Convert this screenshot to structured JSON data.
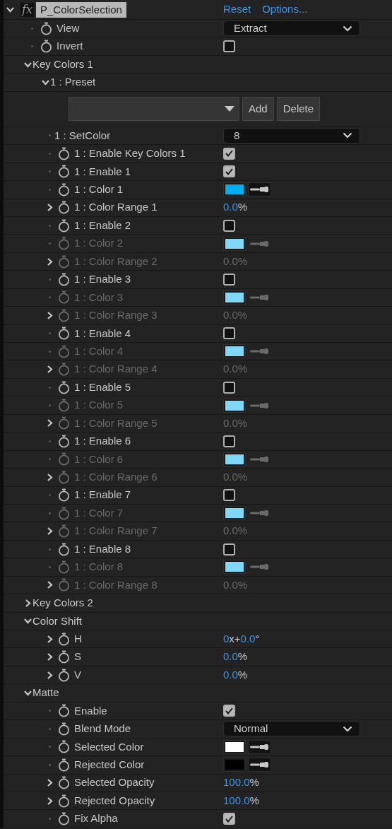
{
  "effect": {
    "badge": "fx",
    "name": "P_ColorSelection",
    "expanded": true,
    "links": [
      "Reset",
      "Options..."
    ],
    "params": [
      {
        "kind": "dropdown",
        "label": "View",
        "stopwatch": true,
        "disabled": false,
        "value": "Extract"
      },
      {
        "kind": "checkbox",
        "label": "Invert",
        "stopwatch": true,
        "disabled": false,
        "checked": false
      },
      {
        "kind": "group",
        "label": "Key Colors 1",
        "expanded": true,
        "children": [
          {
            "kind": "group",
            "label": "1 : Preset",
            "expanded": true,
            "children": [
              {
                "kind": "preset",
                "buttons": [
                  "Add",
                  "Delete"
                ]
              }
            ]
          },
          {
            "kind": "dropdown",
            "label": "1 : SetColor",
            "stopwatch": false,
            "disabled": false,
            "value": "8"
          },
          {
            "kind": "checkbox",
            "label": "1 : Enable Key Colors 1",
            "stopwatch": true,
            "disabled": false,
            "checked": true
          },
          {
            "kind": "checkbox",
            "label": "1 : Enable 1",
            "stopwatch": true,
            "disabled": false,
            "checked": true
          },
          {
            "kind": "color",
            "label": "1 : Color 1",
            "stopwatch": true,
            "disabled": false,
            "color": "#00aeef"
          },
          {
            "kind": "number",
            "label": "1 : Color Range 1",
            "stopwatch": true,
            "disabled": false,
            "expanded": false,
            "parts": [
              "0.0",
              "%"
            ]
          },
          {
            "kind": "checkbox",
            "label": "1 : Enable 2",
            "stopwatch": true,
            "disabled": false,
            "checked": false
          },
          {
            "kind": "color",
            "label": "1 : Color 2",
            "stopwatch": true,
            "disabled": true,
            "color": "#80d7f7"
          },
          {
            "kind": "number",
            "label": "1 : Color Range 2",
            "stopwatch": true,
            "disabled": true,
            "expanded": false,
            "parts": [
              "0.0",
              "%"
            ]
          },
          {
            "kind": "checkbox",
            "label": "1 : Enable 3",
            "stopwatch": true,
            "disabled": false,
            "checked": false
          },
          {
            "kind": "color",
            "label": "1 : Color 3",
            "stopwatch": true,
            "disabled": true,
            "color": "#80d7f7"
          },
          {
            "kind": "number",
            "label": "1 : Color Range 3",
            "stopwatch": true,
            "disabled": true,
            "expanded": false,
            "parts": [
              "0.0",
              "%"
            ]
          },
          {
            "kind": "checkbox",
            "label": "1 : Enable 4",
            "stopwatch": true,
            "disabled": false,
            "checked": false
          },
          {
            "kind": "color",
            "label": "1 : Color 4",
            "stopwatch": true,
            "disabled": true,
            "color": "#80d7f7"
          },
          {
            "kind": "number",
            "label": "1 : Color Range 4",
            "stopwatch": true,
            "disabled": true,
            "expanded": false,
            "parts": [
              "0.0",
              "%"
            ]
          },
          {
            "kind": "checkbox",
            "label": "1 : Enable 5",
            "stopwatch": true,
            "disabled": false,
            "checked": false
          },
          {
            "kind": "color",
            "label": "1 : Color 5",
            "stopwatch": true,
            "disabled": true,
            "color": "#80d7f7"
          },
          {
            "kind": "number",
            "label": "1 : Color Range 5",
            "stopwatch": true,
            "disabled": true,
            "expanded": false,
            "parts": [
              "0.0",
              "%"
            ]
          },
          {
            "kind": "checkbox",
            "label": "1 : Enable 6",
            "stopwatch": true,
            "disabled": false,
            "checked": false
          },
          {
            "kind": "color",
            "label": "1 : Color 6",
            "stopwatch": true,
            "disabled": true,
            "color": "#80d7f7"
          },
          {
            "kind": "number",
            "label": "1 : Color Range 6",
            "stopwatch": true,
            "disabled": true,
            "expanded": false,
            "parts": [
              "0.0",
              "%"
            ]
          },
          {
            "kind": "checkbox",
            "label": "1 : Enable 7",
            "stopwatch": true,
            "disabled": false,
            "checked": false
          },
          {
            "kind": "color",
            "label": "1 : Color 7",
            "stopwatch": true,
            "disabled": true,
            "color": "#80d7f7"
          },
          {
            "kind": "number",
            "label": "1 : Color Range 7",
            "stopwatch": true,
            "disabled": true,
            "expanded": false,
            "parts": [
              "0.0",
              "%"
            ]
          },
          {
            "kind": "checkbox",
            "label": "1 : Enable 8",
            "stopwatch": true,
            "disabled": false,
            "checked": false
          },
          {
            "kind": "color",
            "label": "1 : Color 8",
            "stopwatch": true,
            "disabled": true,
            "color": "#80d7f7"
          },
          {
            "kind": "number",
            "label": "1 : Color Range 8",
            "stopwatch": true,
            "disabled": true,
            "expanded": false,
            "parts": [
              "0.0",
              "%"
            ]
          }
        ]
      },
      {
        "kind": "group",
        "label": "Key Colors 2",
        "expanded": false
      },
      {
        "kind": "group",
        "label": "Color Shift",
        "expanded": true,
        "children": [
          {
            "kind": "number",
            "label": "H",
            "stopwatch": true,
            "disabled": false,
            "expanded": false,
            "parts": [
              "0",
              "x+",
              "0.0",
              "°"
            ]
          },
          {
            "kind": "number",
            "label": "S",
            "stopwatch": true,
            "disabled": false,
            "expanded": false,
            "parts": [
              "0.0",
              "%"
            ]
          },
          {
            "kind": "number",
            "label": "V",
            "stopwatch": true,
            "disabled": false,
            "expanded": false,
            "parts": [
              "0.0",
              "%"
            ]
          }
        ]
      },
      {
        "kind": "group",
        "label": "Matte",
        "expanded": true,
        "children": [
          {
            "kind": "checkbox",
            "label": "Enable",
            "stopwatch": true,
            "disabled": false,
            "checked": true
          },
          {
            "kind": "dropdown",
            "label": "Blend Mode",
            "stopwatch": true,
            "disabled": false,
            "value": "Normal"
          },
          {
            "kind": "color",
            "label": "Selected Color",
            "stopwatch": true,
            "disabled": false,
            "color": "#ffffff"
          },
          {
            "kind": "color",
            "label": "Rejected Color",
            "stopwatch": true,
            "disabled": false,
            "color": "#000000"
          },
          {
            "kind": "number",
            "label": "Selected Opacity",
            "stopwatch": true,
            "disabled": false,
            "expanded": false,
            "parts": [
              "100.0",
              "%"
            ]
          },
          {
            "kind": "number",
            "label": "Rejected Opacity",
            "stopwatch": true,
            "disabled": false,
            "expanded": false,
            "parts": [
              "100.0",
              "%"
            ]
          },
          {
            "kind": "checkbox",
            "label": "Fix Alpha",
            "stopwatch": true,
            "disabled": false,
            "checked": true
          }
        ]
      }
    ]
  }
}
